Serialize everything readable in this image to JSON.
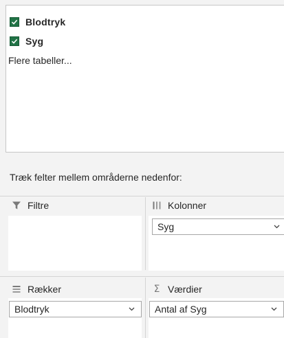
{
  "fields": [
    {
      "label": "Blodtryk",
      "checked": true
    },
    {
      "label": "Syg",
      "checked": true
    }
  ],
  "more_tables_label": "Flere tabeller...",
  "instruction": "Træk felter mellem områderne nedenfor:",
  "areas": {
    "filters": {
      "label": "Filtre",
      "icon": "filter-icon",
      "items": []
    },
    "columns": {
      "label": "Kolonner",
      "icon": "columns-icon",
      "items": [
        "Syg"
      ]
    },
    "rows": {
      "label": "Rækker",
      "icon": "rows-icon",
      "items": [
        "Blodtryk"
      ]
    },
    "values": {
      "label": "Værdier",
      "icon": "sigma-icon",
      "items": [
        "Antal af Syg"
      ]
    }
  },
  "colors": {
    "checkbox_green": "#217346",
    "panel_bg": "#f3f3f3",
    "box_bg": "#ffffff"
  }
}
